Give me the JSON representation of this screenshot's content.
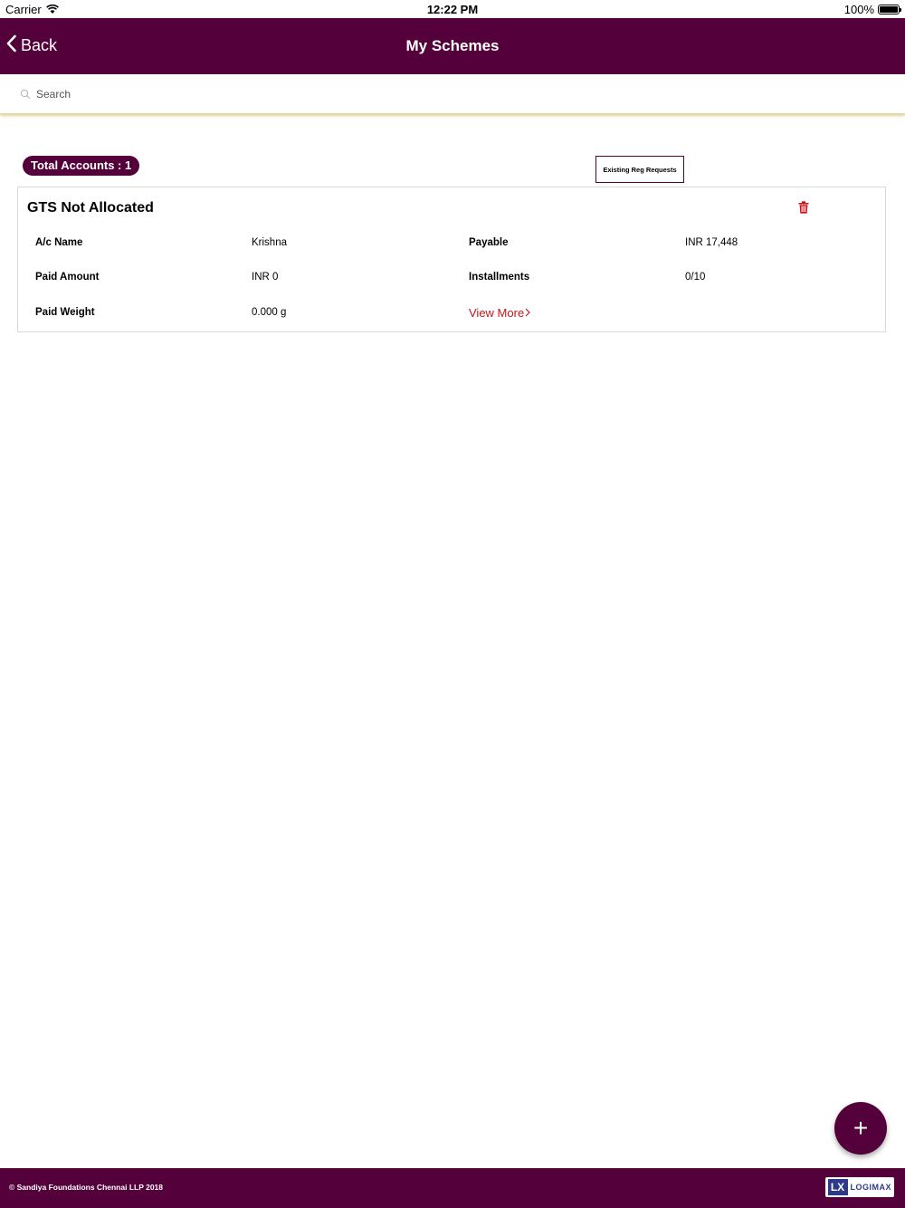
{
  "status_bar": {
    "carrier": "Carrier",
    "time": "12:22 PM",
    "battery": "100%"
  },
  "nav": {
    "back_label": "Back",
    "title": "My Schemes"
  },
  "search": {
    "placeholder": "Search",
    "value": ""
  },
  "summary": {
    "total_accounts": "Total Accounts : 1",
    "existing_button": "Existing Reg Requests"
  },
  "card": {
    "title": "GTS Not Allocated",
    "ac_name_label": "A/c Name",
    "ac_name_value": "Krishna",
    "payable_label": "Payable",
    "payable_value": "INR 17,448",
    "paid_amount_label": "Paid Amount",
    "paid_amount_value": "INR 0",
    "installments_label": "Installments",
    "installments_value": "0/10",
    "paid_weight_label": "Paid Weight",
    "paid_weight_value": "0.000 g",
    "view_more_label": "View More"
  },
  "fab": {
    "label": "+"
  },
  "footer": {
    "copyright": "© Sandiya Foundations Chennai LLP 2018",
    "logo_mark": "LX",
    "logo_name": "LOGIMAX"
  },
  "colors": {
    "brand": "#54003a",
    "danger": "#c0161b"
  },
  "icons": [
    "wifi-icon",
    "battery-icon",
    "chevron-left-icon",
    "search-icon",
    "trash-icon",
    "chevron-right-icon",
    "plus-icon"
  ]
}
